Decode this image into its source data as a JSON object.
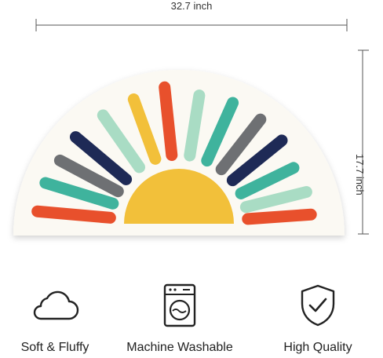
{
  "dimensions": {
    "width": "32.7 inch",
    "height": "17.7 inch"
  },
  "rug": {
    "colors": {
      "base": "#fbf9f3",
      "sun": "#f2c03a",
      "orange": "#e8502c",
      "mint": "#a9dcc4",
      "navy": "#1e2a56",
      "gray": "#6e7073",
      "teal": "#3fb39d"
    }
  },
  "features": [
    {
      "icon": "cloud-icon",
      "label": "Soft & Fluffy"
    },
    {
      "icon": "washing-machine-icon",
      "label": "Machine Washable"
    },
    {
      "icon": "shield-check-icon",
      "label": "High Quality"
    }
  ]
}
